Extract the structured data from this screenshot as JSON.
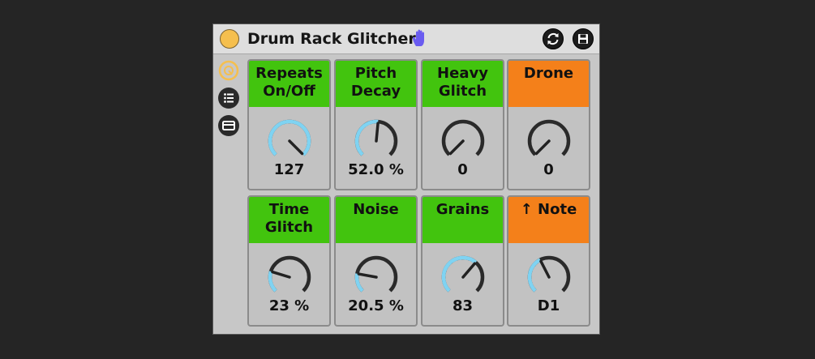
{
  "device": {
    "title": "Drum Rack Glitcher",
    "colors": {
      "power_on": "#f5bf4e",
      "accent_green": "#42c40e",
      "accent_orange": "#f4801a",
      "knob_arc": "#7fd3f2",
      "knob_track": "#2a2a2a",
      "hand_icon": "#6a5cf0"
    },
    "icons": {
      "power": "power-toggle-icon",
      "hand": "hand-icon",
      "refresh": "refresh-icon",
      "save": "save-icon",
      "macro_view": "macro-knob-view-icon",
      "chain_list": "chain-list-icon",
      "devices": "device-view-icon"
    }
  },
  "macros": [
    {
      "label_line1": "Repeats",
      "label_line2": "On/Off",
      "value": "127",
      "level": 1.0,
      "color": "green"
    },
    {
      "label_line1": "Pitch",
      "label_line2": "Decay",
      "value": "52.0 %",
      "level": 0.52,
      "color": "green"
    },
    {
      "label_line1": "Heavy",
      "label_line2": "Glitch",
      "value": "0",
      "level": 0.0,
      "color": "green"
    },
    {
      "label_line1": "Drone",
      "label_line2": "",
      "value": "0",
      "level": 0.0,
      "color": "orange"
    },
    {
      "label_line1": "Time",
      "label_line2": "Glitch",
      "value": "23 %",
      "level": 0.23,
      "color": "green"
    },
    {
      "label_line1": "Noise",
      "label_line2": "",
      "value": "20.5 %",
      "level": 0.205,
      "color": "green"
    },
    {
      "label_line1": "Grains",
      "label_line2": "",
      "value": "83",
      "level": 0.65,
      "color": "green"
    },
    {
      "label_line1": "↑ Note",
      "label_line2": "",
      "value": "D1",
      "level": 0.4,
      "color": "orange"
    }
  ]
}
